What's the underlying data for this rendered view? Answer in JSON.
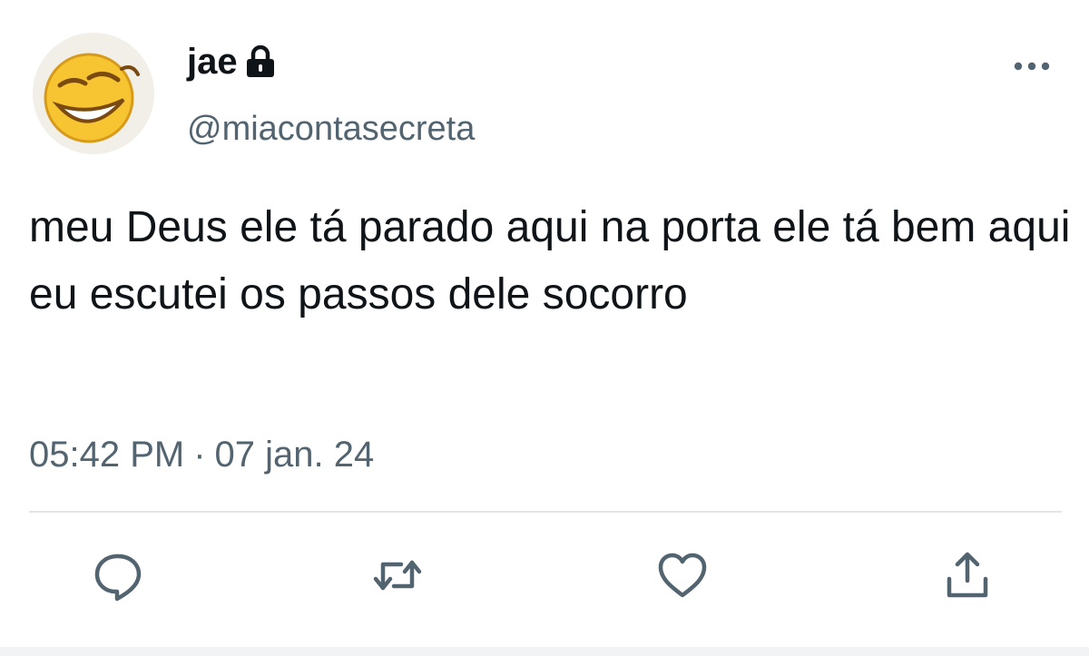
{
  "tweet": {
    "author": {
      "display_name": "jae",
      "handle": "@miacontasecreta",
      "verified_icon": "lock-icon",
      "avatar": "laughing-emoji-avatar"
    },
    "text": "meu Deus ele tá parado aqui na porta ele tá bem aqui eu escutei os passos dele socorro",
    "time": "05:42 PM",
    "separator": "·",
    "date": "07 jan. 24"
  },
  "actions": [
    {
      "name": "reply",
      "icon": "reply-icon"
    },
    {
      "name": "retweet",
      "icon": "retweet-icon"
    },
    {
      "name": "like",
      "icon": "heart-icon"
    },
    {
      "name": "share",
      "icon": "share-icon"
    }
  ],
  "colors": {
    "text": "#0f1419",
    "secondary": "#536471",
    "icon": "#536471",
    "divider": "#e1e6ea"
  }
}
